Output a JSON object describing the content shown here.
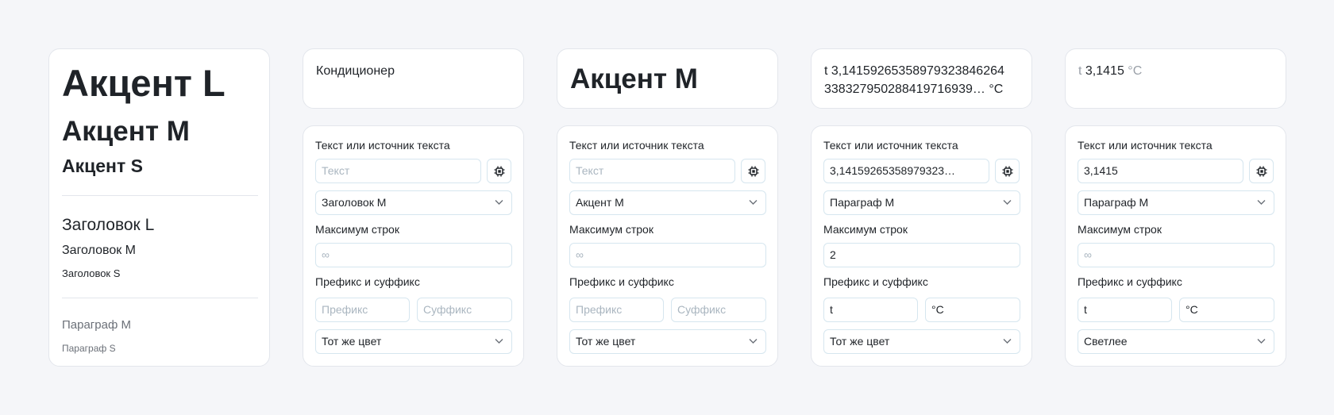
{
  "samples": {
    "accent_l": "Акцент L",
    "accent_m": "Акцент M",
    "accent_s": "Акцент S",
    "heading_l": "Заголовок L",
    "heading_m": "Заголовок M",
    "heading_s": "Заголовок S",
    "paragraph_m": "Параграф M",
    "paragraph_s": "Параграф S"
  },
  "labels": {
    "text_source": "Текст или источник текста",
    "max_lines": "Максимум строк",
    "prefix_suffix": "Префикс и суффикс"
  },
  "placeholders": {
    "text": "Текст",
    "max_lines": "∞",
    "prefix": "Префикс",
    "suffix": "Суффикс"
  },
  "icons": {
    "chip": "chip-icon",
    "chevron": "chevron-down-icon"
  },
  "columns": [
    {
      "preview": {
        "main": "Кондиционер"
      },
      "text_value": "",
      "style": "Заголовок M",
      "max_lines": "",
      "prefix": "",
      "suffix": "",
      "color": "Тот же цвет"
    },
    {
      "preview": {
        "main": "Акцент M"
      },
      "text_value": "",
      "style": "Акцент M",
      "max_lines": "",
      "prefix": "",
      "suffix": "",
      "color": "Тот же цвет"
    },
    {
      "preview": {
        "line1": "t 3,14159265358979323846264",
        "line2": "338327950288419716939… °C"
      },
      "text_value": "3,14159265358979323…",
      "style": "Параграф M",
      "max_lines": "2",
      "prefix": "t",
      "suffix": "°C",
      "color": "Тот же цвет"
    },
    {
      "preview": {
        "prefix": "t",
        "value": "3,1415",
        "suffix": "°C"
      },
      "text_value": "3,1415",
      "style": "Параграф M",
      "max_lines": "",
      "prefix": "t",
      "suffix": "°C",
      "color": "Светлее"
    }
  ],
  "theme": {
    "background": "#f5f6f9",
    "card_border": "#e3e6ec",
    "field_border": "#d6e6ef",
    "placeholder": "#aab6c0",
    "muted_text": "#6b7078"
  }
}
